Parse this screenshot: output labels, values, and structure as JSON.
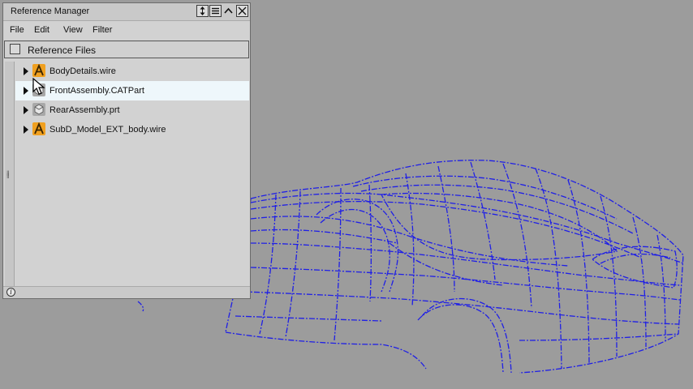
{
  "window": {
    "title": "Reference Manager",
    "buttons": [
      "resize-icon",
      "menu-icon",
      "collapse-icon",
      "close-icon"
    ]
  },
  "menu": [
    "File",
    "Edit",
    "View",
    "Filter"
  ],
  "reference_header": {
    "label": "Reference Files",
    "checked": false
  },
  "files": [
    {
      "name": "BodyDetails.wire",
      "icon": "alias-wire-icon",
      "highlighted": false
    },
    {
      "name": "FrontAssembly.CATPart",
      "icon": "catpart-icon",
      "highlighted": true
    },
    {
      "name": "RearAssembly.prt",
      "icon": "prt-part-icon",
      "highlighted": false
    },
    {
      "name": "SubD_Model_EXT_body.wire",
      "icon": "alias-wire-icon",
      "highlighted": false
    }
  ],
  "status": {
    "icon": "info-icon"
  },
  "colors": {
    "viewport_background": "#9c9c9c",
    "wireframe": "#1f1fe6",
    "panel": "#d2d2d2",
    "row_highlight": "#eef7fb",
    "alias_icon": "#f0a020"
  }
}
